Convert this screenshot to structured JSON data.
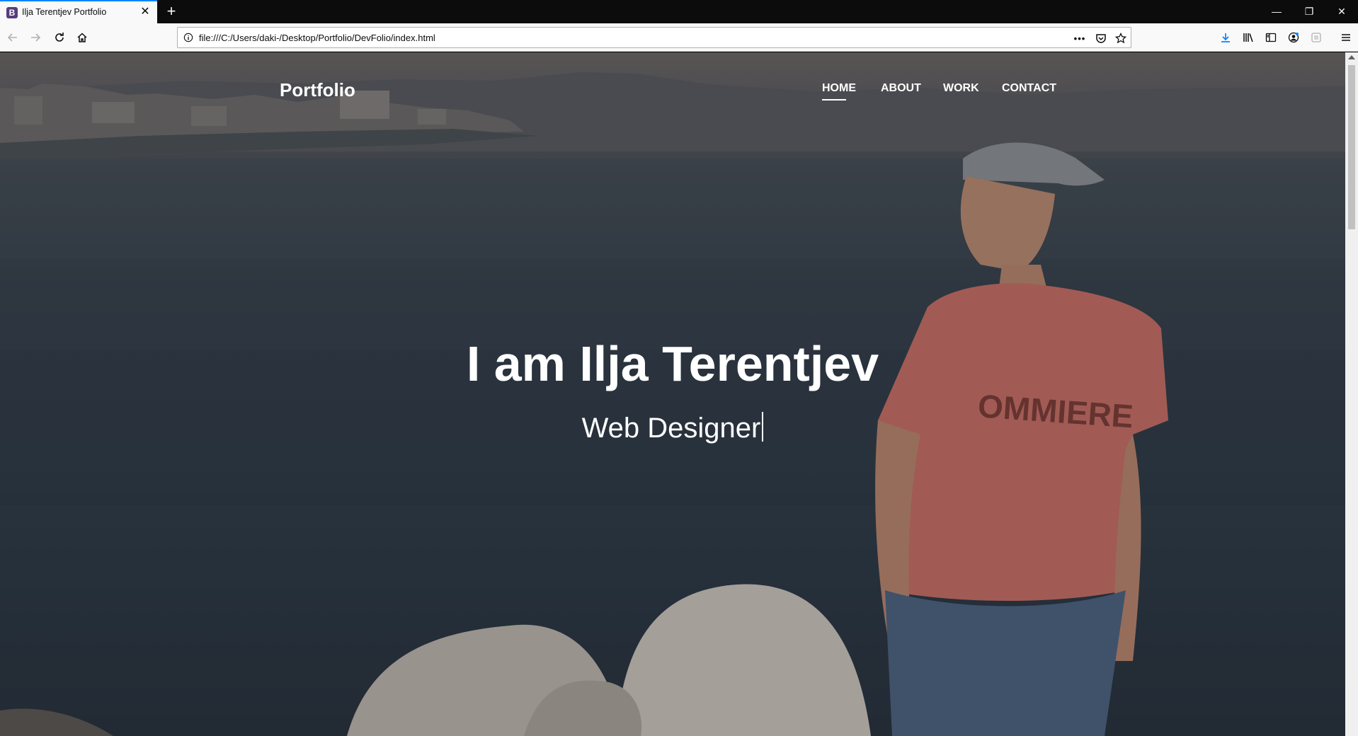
{
  "browser": {
    "tab_title": "Ilja Terentjev Portfolio",
    "tab_favicon_letter": "B",
    "new_tab_label": "+",
    "close_tab_glyph": "✕",
    "url": "file:///C:/Users/daki-/Desktop/Portfolio/DevFolio/index.html",
    "more_glyph": "•••",
    "window_controls": {
      "minimize": "—",
      "maximize": "❐",
      "close": "✕"
    }
  },
  "site": {
    "brand": "Portfolio",
    "nav": [
      {
        "label": "HOME",
        "active": true
      },
      {
        "label": "ABOUT",
        "active": false
      },
      {
        "label": "WORK",
        "active": false
      },
      {
        "label": "CONTACT",
        "active": false
      }
    ],
    "hero": {
      "title": "I am Ilja Terentjev",
      "subtitle": "Web Designer"
    }
  },
  "colors": {
    "accent": "#0a84ff",
    "favicon": "#563d7c",
    "text_on_hero": "#ffffff"
  },
  "icons": [
    "back-arrow-icon",
    "forward-arrow-icon",
    "reload-icon",
    "home-icon",
    "info-icon",
    "pocket-icon",
    "star-icon",
    "download-icon",
    "library-icon",
    "sidebar-icon",
    "account-icon",
    "extension-icon",
    "hamburger-menu-icon"
  ]
}
